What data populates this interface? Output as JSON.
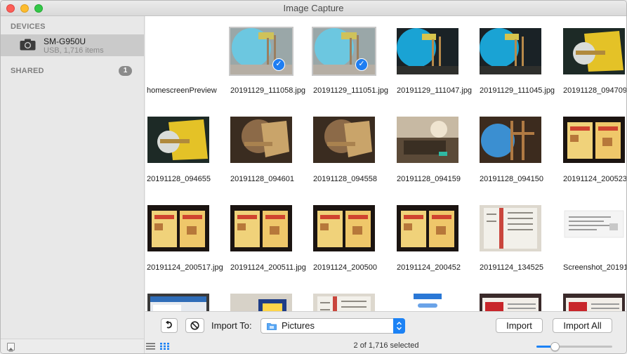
{
  "window": {
    "title": "Image Capture"
  },
  "sidebar": {
    "devices_header": "DEVICES",
    "device": {
      "name": "SM-G950U",
      "subtitle": "USB, 1,716 items",
      "icon": "camera-icon"
    },
    "shared_header": "SHARED",
    "shared_count": "1"
  },
  "grid": {
    "rows": [
      [
        {
          "caption": "homescreenPreview",
          "thumb": "blank",
          "selected": false
        },
        {
          "caption": "20191129_111058.jpg",
          "thumb": "balloon-pale",
          "selected": true
        },
        {
          "caption": "20191129_111051.jpg",
          "thumb": "balloon-pale",
          "selected": true
        },
        {
          "caption": "20191129_111047.jpg",
          "thumb": "balloon-dark",
          "selected": false
        },
        {
          "caption": "20191129_111045.jpg",
          "thumb": "balloon-dark",
          "selected": false
        },
        {
          "caption": "20191128_094709",
          "thumb": "yellow-device",
          "selected": false
        }
      ],
      [
        {
          "caption": "20191128_094655",
          "thumb": "yellow-device",
          "selected": false
        },
        {
          "caption": "20191128_094601",
          "thumb": "bronze",
          "selected": false
        },
        {
          "caption": "20191128_094558",
          "thumb": "bronze",
          "selected": false
        },
        {
          "caption": "20191128_094159",
          "thumb": "room",
          "selected": false
        },
        {
          "caption": "20191128_094150",
          "thumb": "balloon-room",
          "selected": false
        },
        {
          "caption": "20191124_200523",
          "thumb": "menu",
          "selected": false
        }
      ],
      [
        {
          "caption": "20191124_200517.jpg",
          "thumb": "menu",
          "selected": false
        },
        {
          "caption": "20191124_200511.jpg",
          "thumb": "menu",
          "selected": false
        },
        {
          "caption": "20191124_200500",
          "thumb": "menu",
          "selected": false
        },
        {
          "caption": "20191124_200452",
          "thumb": "menu",
          "selected": false
        },
        {
          "caption": "20191124_134525",
          "thumb": "paper",
          "selected": false
        },
        {
          "caption": "Screenshot_20191",
          "thumb": "screenshot",
          "selected": false
        }
      ],
      [
        {
          "caption": "",
          "thumb": "screen-blue",
          "selected": false
        },
        {
          "caption": "",
          "thumb": "grey-blue",
          "selected": false
        },
        {
          "caption": "",
          "thumb": "paper",
          "selected": false
        },
        {
          "caption": "",
          "thumb": "app-screenshot",
          "selected": false
        },
        {
          "caption": "",
          "thumb": "red-paper",
          "selected": false
        },
        {
          "caption": "",
          "thumb": "red-paper",
          "selected": false
        }
      ]
    ]
  },
  "bottom": {
    "import_to_label": "Import To:",
    "destination": "Pictures",
    "import_label": "Import",
    "import_all_label": "Import All",
    "status": "2 of 1,716 selected",
    "thumbnail_size_fraction": 0.2
  }
}
